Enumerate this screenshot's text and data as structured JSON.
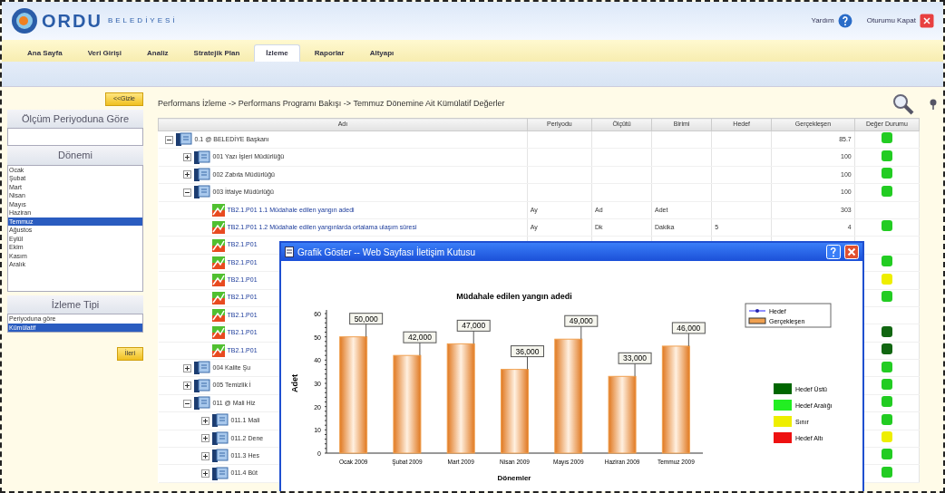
{
  "header": {
    "logo_text": "ORDU",
    "logo_subtext": "BELEDİYESİ",
    "links": [
      {
        "label": "Yardım",
        "kind": "help"
      },
      {
        "label": "Oturumu Kapat",
        "kind": "logout"
      }
    ]
  },
  "menu": [
    {
      "label": "Ana Sayfa",
      "selected": false
    },
    {
      "label": "Veri Girişi",
      "selected": false
    },
    {
      "label": "Analiz",
      "selected": false
    },
    {
      "label": "Stratejik Plan",
      "selected": false
    },
    {
      "label": "İzleme",
      "selected": true
    },
    {
      "label": "Raporlar",
      "selected": false
    },
    {
      "label": "Altyapı",
      "selected": false
    }
  ],
  "sidebar": {
    "hide_button": "<<Gizle",
    "period_heading": "Ölçüm Periyoduna Göre",
    "period_heading_2": "Dönemi",
    "months": [
      {
        "label": "Ocak",
        "selected": false
      },
      {
        "label": "Şubat",
        "selected": false
      },
      {
        "label": "Mart",
        "selected": false
      },
      {
        "label": "Nisan",
        "selected": false
      },
      {
        "label": "Mayıs",
        "selected": false
      },
      {
        "label": "Haziran",
        "selected": false
      },
      {
        "label": "Temmuz",
        "selected": true
      },
      {
        "label": "Ağustos",
        "selected": false
      },
      {
        "label": "Eylül",
        "selected": false
      },
      {
        "label": "Ekim",
        "selected": false
      },
      {
        "label": "Kasım",
        "selected": false
      },
      {
        "label": "Aralık",
        "selected": false
      }
    ],
    "type_heading": "İzleme Tipi",
    "types": [
      {
        "label": "Periyoduna göre",
        "selected": false
      },
      {
        "label": "Kümülatif",
        "selected": true
      }
    ],
    "go_button": "İleri"
  },
  "breadcrumb": "Performans İzleme -> Performans Programı Bakışı -> Temmuz Dönemine Ait Kümülatif Değerler",
  "table": {
    "columns": [
      "Adı",
      "Periyodu",
      "Ölçütü",
      "Birimi",
      "Hedef",
      "Gerçekleşen",
      "Değer Durumu"
    ],
    "rows": [
      {
        "kind": "unit",
        "name": "0.1 @ BELEDİYE Başkanı",
        "expanded": true,
        "values": {
          "gerceklesen": "85.7"
        },
        "color": "#22cc22",
        "children": [
          {
            "kind": "unit",
            "name": "001 Yazı İşleri Müdürlüğü",
            "expanded": false,
            "values": {
              "gerceklesen": "100"
            },
            "color": "#22cc22"
          },
          {
            "kind": "unit",
            "name": "002 Zabıta Müdürlüğü",
            "expanded": false,
            "values": {
              "gerceklesen": "100"
            },
            "color": "#22cc22"
          },
          {
            "kind": "unit",
            "name": "003 İtfaiye Müdürlüğü",
            "expanded": true,
            "values": {
              "gerceklesen": "100"
            },
            "color": "#22cc22",
            "children": [
              {
                "kind": "indicator",
                "name": "TB2.1.P01 1.1 Müdahale edilen yangın adedi",
                "values": {
                  "periyodu": "Ay",
                  "olcutu": "Ad",
                  "birimi": "Adet",
                  "gerceklesen": "303"
                }
              },
              {
                "kind": "indicator",
                "name": "TB2.1.P01 1.2 Müdahale edilen yangınlarda ortalama ulaşım süresi",
                "values": {
                  "periyodu": "Ay",
                  "olcutu": "Dk",
                  "birimi": "Dakika",
                  "hedef": "5",
                  "gerceklesen": "4"
                },
                "color": "#22cc22"
              },
              {
                "kind": "indicator",
                "name": "TB2.1.P01"
              },
              {
                "kind": "indicator",
                "name": "TB2.1.P01",
                "color": "#22cc22"
              },
              {
                "kind": "indicator",
                "name": "TB2.1.P01",
                "color": "#eeee00"
              },
              {
                "kind": "indicator",
                "name": "TB2.1.P01",
                "color": "#22cc22"
              },
              {
                "kind": "indicator",
                "name": "TB2.1.P01"
              },
              {
                "kind": "indicator",
                "name": "TB2.1.P01",
                "color": "#116611"
              },
              {
                "kind": "indicator",
                "name": "TB2.1.P01",
                "color": "#116611"
              }
            ]
          },
          {
            "kind": "unit",
            "name": "004 Kalite Şu",
            "expanded": false,
            "color": "#22cc22"
          },
          {
            "kind": "unit",
            "name": "005 Temizlik İ",
            "expanded": false,
            "color": "#22cc22"
          },
          {
            "kind": "unit",
            "name": "011 @ Mali Hiz",
            "expanded": true,
            "color": "#22cc22",
            "children": [
              {
                "kind": "unit",
                "name": "011.1 Mali",
                "expanded": false,
                "color": "#22cc22"
              },
              {
                "kind": "unit",
                "name": "011.2 Dene",
                "expanded": false,
                "color": "#eeee00"
              },
              {
                "kind": "unit",
                "name": "011.3 Hes",
                "expanded": false,
                "color": "#22cc22"
              },
              {
                "kind": "unit",
                "name": "011.4 Büt",
                "expanded": false,
                "color": "#22cc22"
              }
            ]
          }
        ]
      }
    ]
  },
  "dialog": {
    "title": "Grafik Göster -- Web Sayfası İletişim Kutusu",
    "chart_data": {
      "type": "bar",
      "title": "Müdahale edilen yangın adedi",
      "xlabel": "Dönemler",
      "ylabel": "Adet",
      "categories": [
        "Ocak 2009",
        "Şubat 2009",
        "Mart 2009",
        "Nisan 2009",
        "Mayıs 2009",
        "Haziran 2009",
        "Temmuz 2009"
      ],
      "series": [
        {
          "name": "Gerçekleşen",
          "color": "#f0a050",
          "values": [
            50,
            42,
            47,
            36,
            49,
            33,
            46
          ]
        }
      ],
      "ylim": [
        0,
        60
      ],
      "yticks": [
        0,
        10,
        20,
        30,
        40,
        50,
        60
      ],
      "value_labels": [
        "50,000",
        "42,000",
        "47,000",
        "36,000",
        "49,000",
        "33,000",
        "46,000"
      ]
    },
    "line_legend": "Hedef",
    "status_legend": [
      {
        "label": "Hedef Üstü",
        "color": "#006600"
      },
      {
        "label": "Hedef Aralığı",
        "color": "#22ee22"
      },
      {
        "label": "Sınır",
        "color": "#eeee00"
      },
      {
        "label": "Hedef Altı",
        "color": "#ee1111"
      }
    ]
  }
}
